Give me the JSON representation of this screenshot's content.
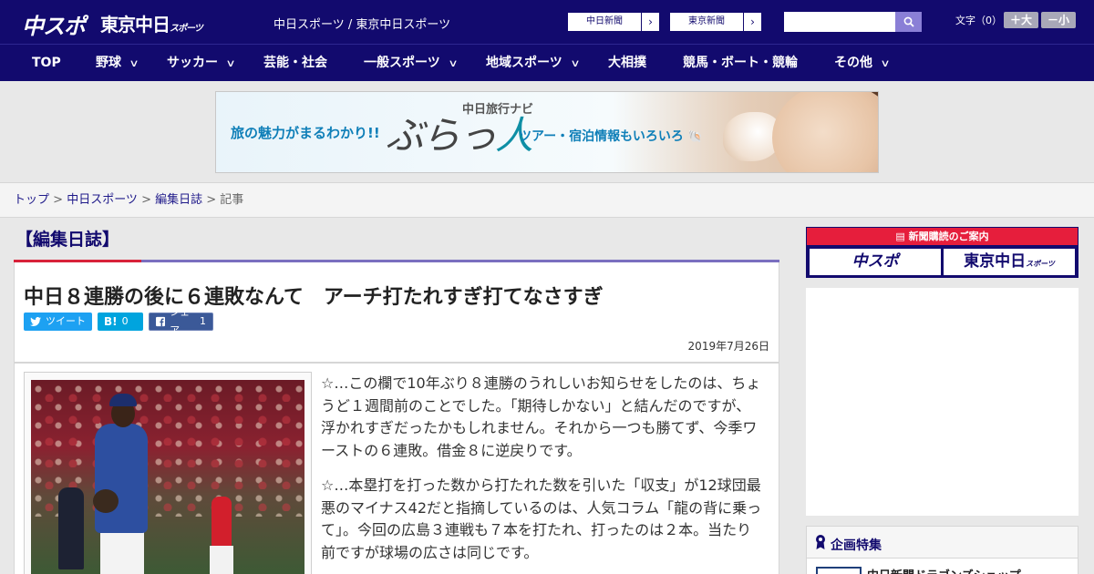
{
  "header": {
    "logo_chuspo": "中スポ",
    "logo_tokyo": "東京中日",
    "logo_tokyo_small": "スポーツ",
    "site_name": "中日スポーツ / 東京中日スポーツ",
    "ext_links": [
      {
        "label": "中日新聞",
        "arrow": "›"
      },
      {
        "label": "東京新聞",
        "arrow": "›"
      }
    ],
    "search_placeholder": "",
    "font_label": "文字（0）",
    "font_larger": "＋大",
    "font_smaller": "－小"
  },
  "nav": {
    "items": [
      {
        "label": "TOP",
        "dropdown": false
      },
      {
        "label": "野球",
        "dropdown": true
      },
      {
        "label": "サッカー",
        "dropdown": true
      },
      {
        "label": "芸能・社会",
        "dropdown": false
      },
      {
        "label": "一般スポーツ",
        "dropdown": true
      },
      {
        "label": "地域スポーツ",
        "dropdown": true
      },
      {
        "label": "大相撲",
        "dropdown": false
      },
      {
        "label": "競馬・ボート・競輪",
        "dropdown": false
      },
      {
        "label": "その他",
        "dropdown": true
      }
    ],
    "chevron": "∨"
  },
  "banner": {
    "tagline_left": "旅の魅力がまるわかり!!",
    "brand_small": "中日旅行ナビ",
    "brand_main_a": "ぶらっ",
    "brand_main_b": "人",
    "tagline_right": "ツアー・宿泊情報もいろいろ"
  },
  "breadcrumb": {
    "items": [
      "トップ",
      "中日スポーツ",
      "編集日誌"
    ],
    "current": "記事",
    "separator": " > "
  },
  "article": {
    "section": "【編集日誌】",
    "headline": "中日８連勝の後に６連敗なんて　アーチ打たれすぎ打てなさすぎ",
    "share": {
      "tweet": "ツイート",
      "hatena_icon": "B!",
      "hatena_count": "0",
      "fb_label": "シェア",
      "fb_count": "1"
    },
    "date": "2019年7月26日",
    "paragraphs": [
      "☆…この欄で10年ぶり８連勝のうれしいお知らせをしたのは、ちょうど１週間前のことでした。「期待しかない」と結んだのですが、浮かれすぎだったかもしれません。それから一つも勝てず、今季ワーストの６連敗。借金８に逆戻りです。",
      "☆…本塁打を打った数から打たれた数を引いた「収支」が12球団最悪のマイナス42だと指摘しているのは、人気コラム「龍の背に乗って」。今回の広島３連戦も７本を打たれ、打ったのは２本。当たり前ですが球場の広さは同じです。"
    ]
  },
  "sidebar": {
    "subscribe_head": "新聞購読のご案内",
    "subscribe_a": "中スポ",
    "subscribe_b": "東京中日",
    "subscribe_b_small": "スポーツ",
    "feature_title": "企画特集",
    "feature_item": "中日新聞ドラゴンズショップ"
  },
  "colors": {
    "brand_navy": "#120a6e",
    "accent_red": "#d8223a",
    "twitter": "#1da1f2",
    "hatena": "#00a4de",
    "facebook": "#3b5998"
  }
}
